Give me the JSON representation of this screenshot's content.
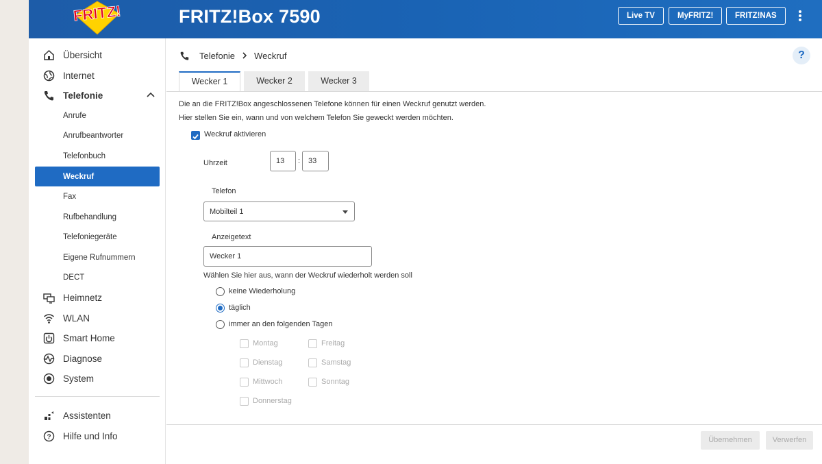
{
  "header": {
    "logo_text": "FRITZ!",
    "title": "FRITZ!Box 7590",
    "buttons": [
      "Live TV",
      "MyFRITZ!",
      "FRITZ!NAS"
    ],
    "menu_icon": "kebab-menu-icon"
  },
  "sidebar": {
    "items": [
      {
        "label": "Übersicht",
        "icon": "home-icon"
      },
      {
        "label": "Internet",
        "icon": "globe-icon"
      },
      {
        "label": "Telefonie",
        "icon": "phone-icon"
      },
      {
        "label": "Heimnetz",
        "icon": "network-icon"
      },
      {
        "label": "WLAN",
        "icon": "wifi-icon"
      },
      {
        "label": "Smart Home",
        "icon": "smart-home-icon"
      },
      {
        "label": "Diagnose",
        "icon": "diagnose-icon"
      },
      {
        "label": "System",
        "icon": "system-icon"
      },
      {
        "label": "Assistenten",
        "icon": "wizard-icon"
      },
      {
        "label": "Hilfe und Info",
        "icon": "help-circle-icon"
      }
    ],
    "telefonie_sub": [
      "Anrufe",
      "Anrufbeantworter",
      "Telefonbuch",
      "Weckruf",
      "Fax",
      "Rufbehandlung",
      "Telefoniegeräte",
      "Eigene Rufnummern",
      "DECT"
    ],
    "active_sub": "Weckruf"
  },
  "breadcrumb": {
    "section": "Telefonie",
    "page": "Weckruf"
  },
  "help_label": "?",
  "tabs": [
    "Wecker 1",
    "Wecker 2",
    "Wecker 3"
  ],
  "active_tab": "Wecker 1",
  "intro": [
    "Die an die FRITZ!Box angeschlossenen Telefone können für einen Weckruf genutzt werden.",
    "Hier stellen Sie ein, wann und von welchem Telefon Sie geweckt werden möchten."
  ],
  "form": {
    "activate_label": "Weckruf aktivieren",
    "activate_checked": true,
    "time_label": "Uhrzeit",
    "hour": "13",
    "time_sep": ":",
    "minute": "33",
    "phone_label": "Telefon",
    "phone_value": "Mobilteil 1",
    "display_label": "Anzeigetext",
    "display_value": "Wecker 1",
    "repeat_label": "Wählen Sie hier aus, wann der Weckruf wiederholt werden soll",
    "repeat_options": [
      "keine Wiederholung",
      "täglich",
      "immer an den folgenden Tagen"
    ],
    "repeat_selected": "täglich",
    "days_left": [
      "Montag",
      "Dienstag",
      "Mittwoch",
      "Donnerstag"
    ],
    "days_right": [
      "Freitag",
      "Samstag",
      "Sonntag"
    ]
  },
  "footer": {
    "apply": "Übernehmen",
    "discard": "Verwerfen"
  },
  "colors": {
    "header": "#1d5ca8",
    "accent": "#1f6bc3",
    "logo_red": "#e2001a",
    "logo_yellow": "#ffd200"
  }
}
